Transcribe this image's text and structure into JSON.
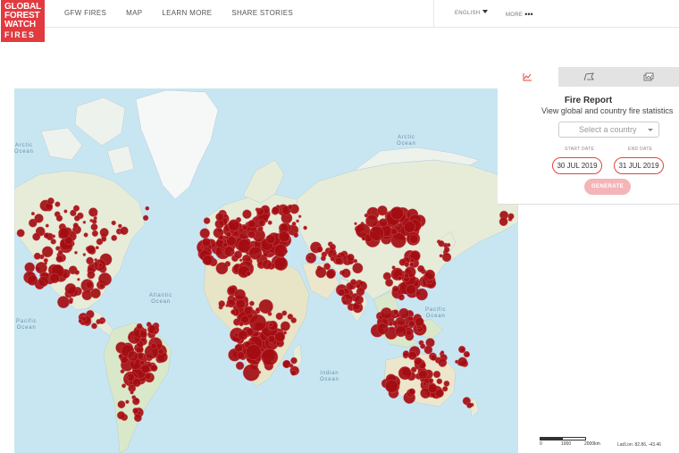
{
  "header": {
    "logo": {
      "line1": "GLOBAL",
      "line2": "FOREST",
      "line3": "WATCH",
      "line4": "FIRES"
    },
    "nav": [
      "GFW FIRES",
      "MAP",
      "LEARN MORE",
      "SHARE STORIES"
    ],
    "language": "ENGLISH",
    "more": "MORE",
    "more_dots": "•••"
  },
  "map": {
    "ocean_labels": {
      "arctic_left": "Arctic",
      "arctic_left_2": "Ocean",
      "arctic_right": "Arctic",
      "arctic_right_2": "Ocean",
      "atlantic": "Atlantic",
      "atlantic_2": "Ocean",
      "pacific_left": "Pacific",
      "pacific_left_2": "Ocean",
      "pacific_right": "Pacific",
      "pacific_right_2": "Ocean",
      "indian": "Indian",
      "indian_2": "Ocean"
    },
    "colors": {
      "ocean": "#c8e6f2",
      "land": "#e9eedd",
      "ice": "#f8fafa",
      "forest": "#b9d6a4",
      "fire": "#a30d12"
    }
  },
  "panel": {
    "tabs": [
      {
        "icon": "chart-icon",
        "active": true
      },
      {
        "icon": "flag-icon",
        "active": false
      },
      {
        "icon": "images-icon",
        "active": false
      }
    ],
    "title": "Fire Report",
    "subtitle": "View global and country fire statistics",
    "country_placeholder": "Select a country",
    "start_label": "START DATE",
    "end_label": "END DATE",
    "start_date": "30 JUL 2019",
    "end_date": "31 JUL 2019",
    "generate_label": "GENERATE",
    "accent_color": "#e1443f"
  },
  "scale": {
    "t0": "0",
    "t1": "1000",
    "t2": "2000km"
  },
  "coordinates": "Lat/Lon: 82.86, -43.46"
}
